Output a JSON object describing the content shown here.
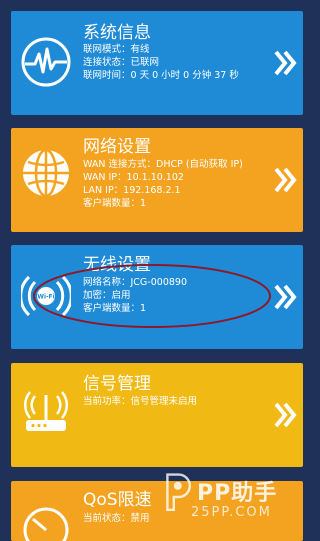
{
  "colors": {
    "background": "#1f3158",
    "blue_card": "#1f8bd6",
    "orange_card": "#f4a321",
    "yellow_card": "#f0b914",
    "ellipse": "#8b1a2b"
  },
  "cards": [
    {
      "title": "系统信息",
      "icon": "heartbeat-globe-icon",
      "lines": [
        "联网模式：有线",
        "连接状态：已联网",
        "联网时间：0 天 0 小时 0 分钟 37 秒"
      ]
    },
    {
      "title": "网络设置",
      "icon": "globe-icon",
      "lines": [
        "WAN 连接方式：DHCP (自动获取 IP)",
        "WAN IP：10.1.10.102",
        "LAN IP：192.168.2.1",
        "客户端数量：1"
      ]
    },
    {
      "title": "无线设置",
      "icon": "wifi-icon",
      "icon_text": "Wi-Fi",
      "lines": [
        "网络名称：JCG-000890",
        "加密：启用",
        "客户端数量：1"
      ]
    },
    {
      "title": "信号管理",
      "icon": "router-icon",
      "lines": [
        "当前功率：信号管理未启用"
      ]
    },
    {
      "title": "QoS限速",
      "icon": "speed-icon",
      "lines": [
        "当前状态：禁用"
      ]
    }
  ],
  "watermark": {
    "brand": "PP助手",
    "url": "25PP.COM"
  }
}
